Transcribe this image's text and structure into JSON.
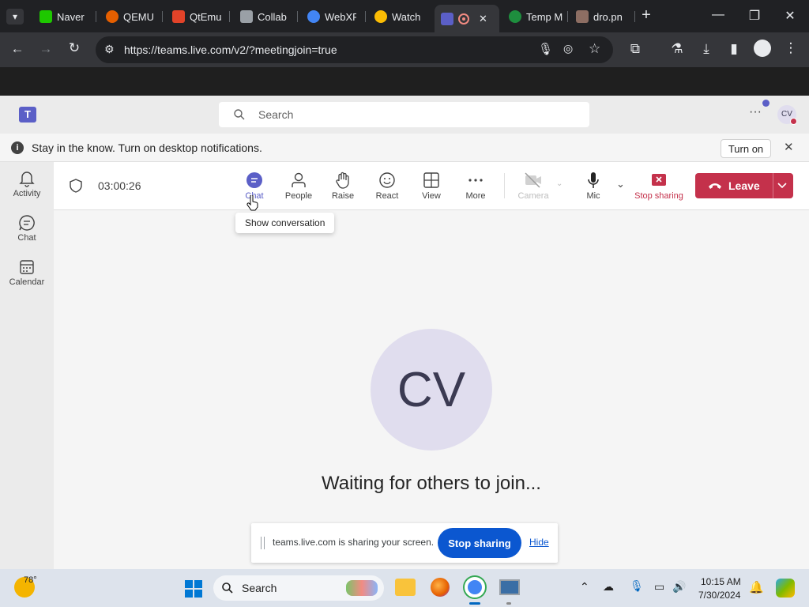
{
  "browser": {
    "tabs": [
      {
        "title": "Naver",
        "color": "#1ec800"
      },
      {
        "title": "QEMU",
        "color": "#e55f00"
      },
      {
        "title": "QtEmu",
        "color": "#e24329"
      },
      {
        "title": "Collab",
        "color": "#9aa0a6"
      },
      {
        "title": "WebXR",
        "color": "#4285f4"
      },
      {
        "title": "Watch",
        "color": "#fbbc04"
      },
      {
        "title": "",
        "color": "#5b5fc7"
      },
      {
        "title": "Temp M",
        "color": "#1e8e3e"
      },
      {
        "title": "dro.pn",
        "color": "#8d6e63"
      }
    ],
    "url": "https://teams.live.com/v2/?meetingjoin=true"
  },
  "teams": {
    "search_placeholder": "Search",
    "user_initials": "CV",
    "notification_text": "Stay in the know. Turn on desktop notifications.",
    "turn_on_label": "Turn on",
    "rail": [
      {
        "label": "Activity"
      },
      {
        "label": "Chat"
      },
      {
        "label": "Calendar"
      }
    ],
    "meeting": {
      "timer": "03:00:26",
      "buttons": {
        "chat": "Chat",
        "people": "People",
        "raise": "Raise",
        "react": "React",
        "view": "View",
        "more": "More",
        "camera": "Camera",
        "mic": "Mic",
        "stop_sharing": "Stop sharing"
      },
      "leave_label": "Leave",
      "tooltip": "Show conversation",
      "avatar_initials": "CV",
      "waiting_text": "Waiting for others to join..."
    }
  },
  "share_bar": {
    "message": "teams.live.com is sharing your screen.",
    "stop_label": "Stop sharing",
    "hide_label": "Hide"
  },
  "taskbar": {
    "weather": "78°",
    "search_placeholder": "Search",
    "time": "10:15 AM",
    "date": "7/30/2024"
  },
  "colors": {
    "teams_purple": "#5b5fc7",
    "leave_red": "#c4314b",
    "chrome_blue": "#0b57d0"
  }
}
